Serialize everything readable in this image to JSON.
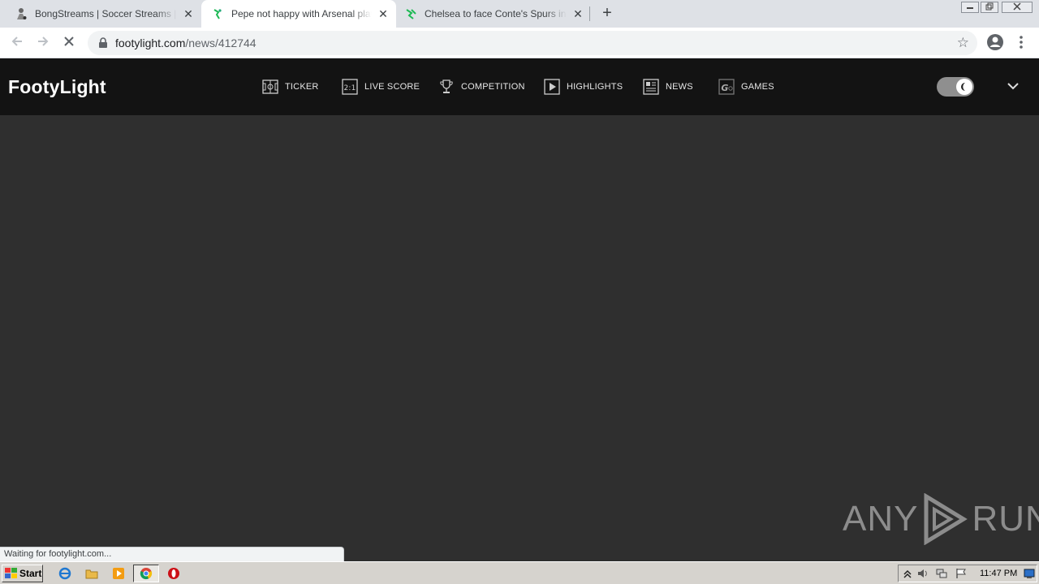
{
  "browser": {
    "tabs": [
      {
        "title": "BongStreams | Soccer Streams | NBA",
        "favicon": "soccer-player-icon",
        "active": false
      },
      {
        "title": "Pepe not happy with Arsenal playing",
        "favicon": "footylight-icon",
        "active": true
      },
      {
        "title": "Chelsea to face Conte's Spurs in EFL",
        "favicon": "footylight-icon",
        "active": false
      }
    ],
    "close_glyph": "✕",
    "new_tab_glyph": "+",
    "url_domain": "footylight.com",
    "url_path": "/news/412744",
    "status_text": "Waiting for footylight.com..."
  },
  "site": {
    "logo": "FootyLight",
    "nav": [
      {
        "label": "TICKER",
        "icon": "pitch-icon"
      },
      {
        "label": "LIVE SCORE",
        "icon": "scoreboard-icon"
      },
      {
        "label": "COMPETITION",
        "icon": "trophy-icon"
      },
      {
        "label": "HIGHLIGHTS",
        "icon": "play-icon"
      },
      {
        "label": "NEWS",
        "icon": "newspaper-icon"
      },
      {
        "label": "GAMES",
        "icon": "gamepad-icon"
      }
    ],
    "theme_toggle_on": true
  },
  "watermark": {
    "left": "ANY",
    "right": "RUN"
  },
  "taskbar": {
    "start_label": "Start",
    "clock": "11:47 PM"
  },
  "colors": {
    "page_bg": "#2f2f2f",
    "header_bg": "#131313",
    "accent_green": "#1db954"
  }
}
